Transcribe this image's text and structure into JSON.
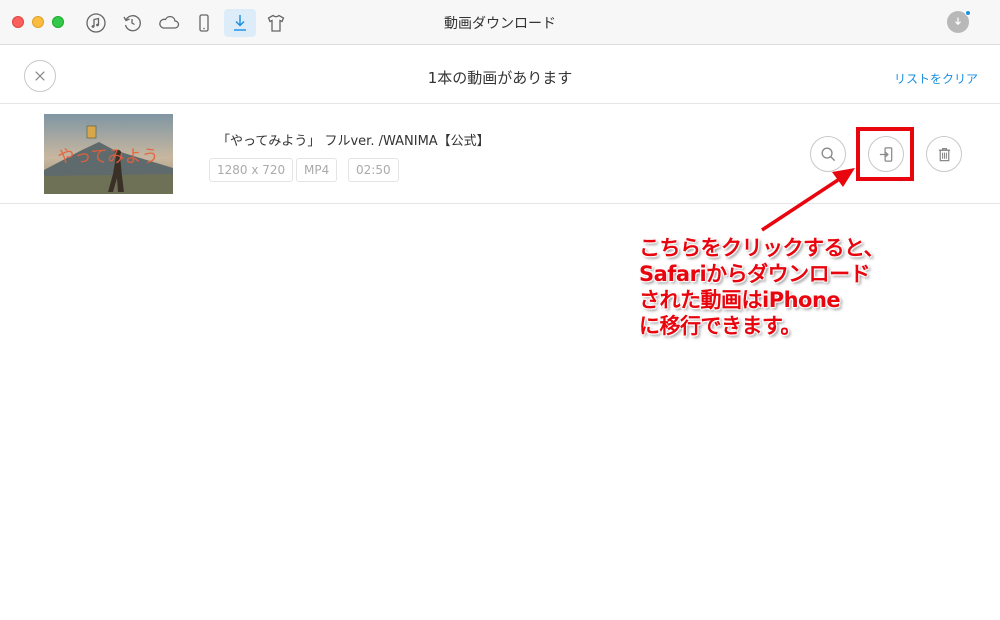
{
  "window": {
    "title": "動画ダウンロード",
    "toolbar_icons": [
      "music-icon",
      "backup-icon",
      "cloud-icon",
      "phone-icon",
      "download-icon",
      "shirt-icon"
    ],
    "active_icon": "download-icon"
  },
  "header": {
    "title": "1本の動画があります",
    "clear_link": "リストをクリア"
  },
  "videos": [
    {
      "thumbnail_text": "やってみよう",
      "title": "「やってみよう」 フルver. /WANIMA【公式】",
      "resolution": "1280 x 720",
      "format": "MP4",
      "duration": "02:50",
      "actions": [
        "search-icon",
        "transfer-to-device-icon",
        "trash-icon"
      ]
    }
  ],
  "annotation": {
    "lines": [
      "こちらをクリックすると、",
      "Safariからダウンロード",
      "された動画はiPhone",
      "に移行できます。"
    ]
  },
  "colors": {
    "accent": "#1a8fe0",
    "annotation_red": "#e8050d",
    "active_tab_bg": "#dcecf8"
  }
}
